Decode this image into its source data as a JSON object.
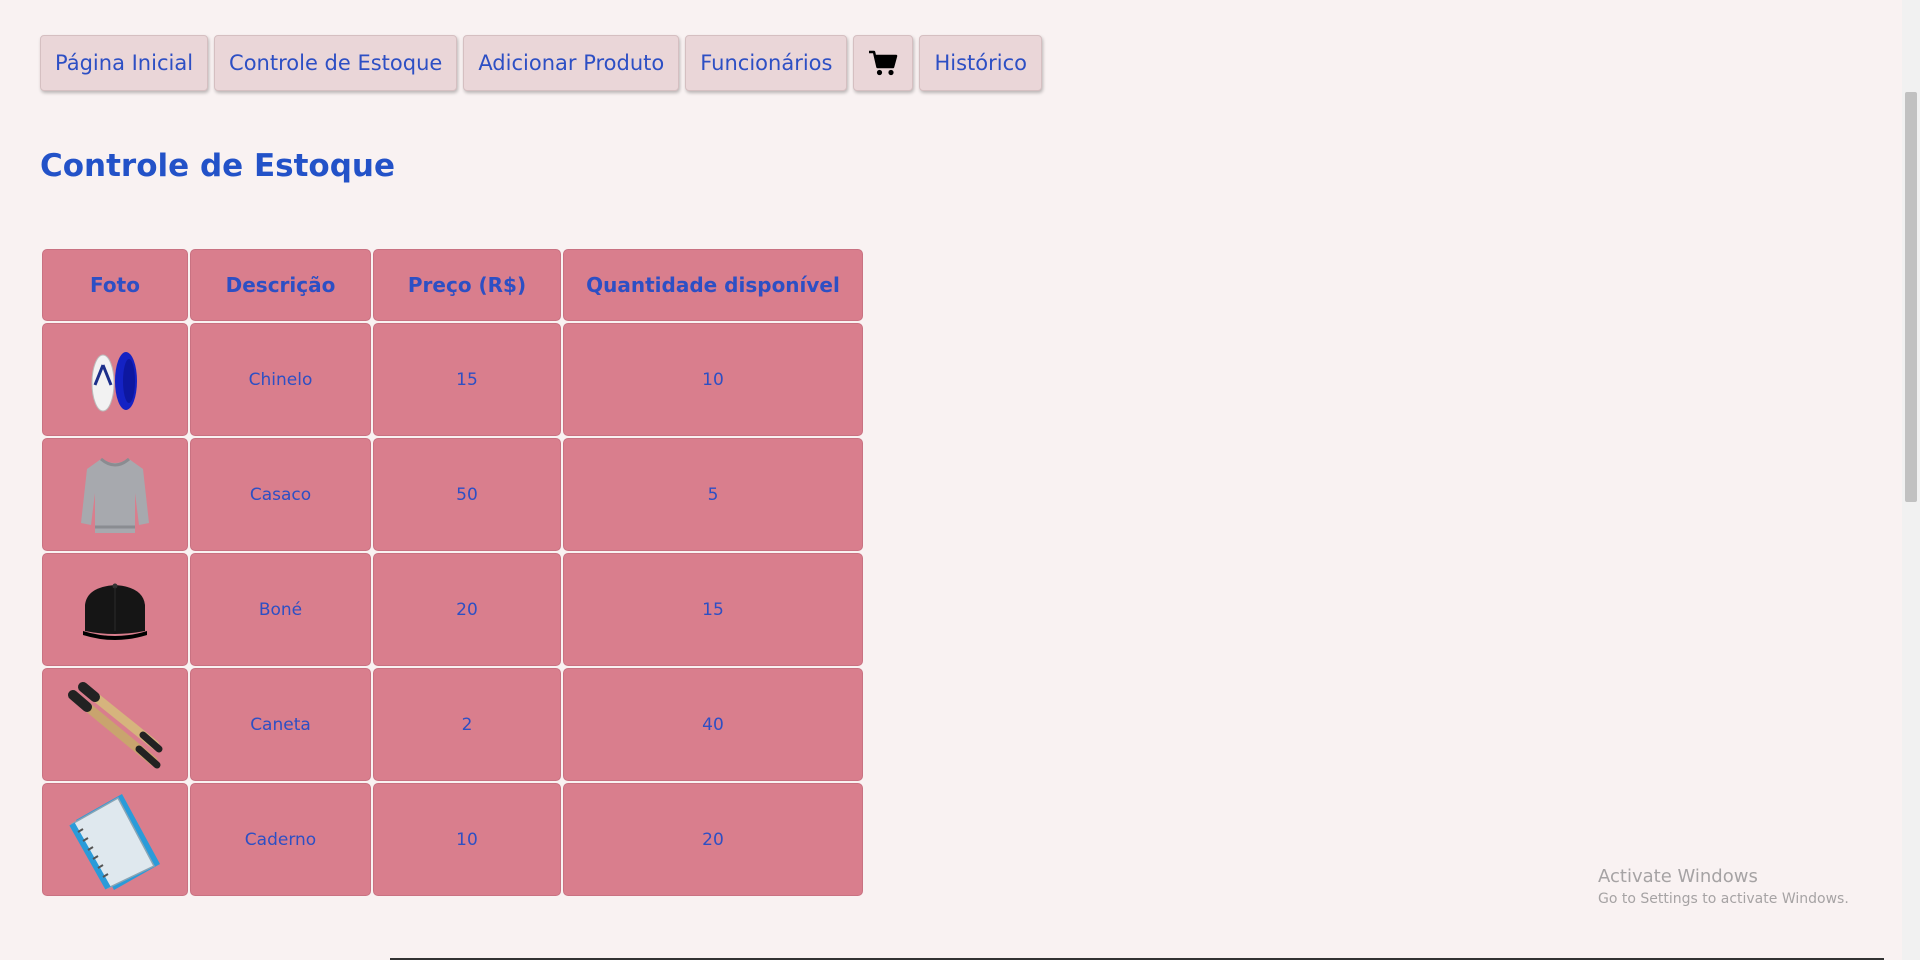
{
  "nav": {
    "items": [
      {
        "label": "Página Inicial"
      },
      {
        "label": "Controle de Estoque"
      },
      {
        "label": "Adicionar Produto"
      },
      {
        "label": "Funcionários"
      },
      {
        "icon": "shopping-cart-icon"
      },
      {
        "label": "Histórico"
      }
    ]
  },
  "page_title": "Controle de Estoque",
  "table": {
    "headers": [
      "Foto",
      "Descrição",
      "Preço (R$)",
      "Quantidade disponível"
    ],
    "rows": [
      {
        "icon": "flip-flop-icon",
        "descricao": "Chinelo",
        "preco": "15",
        "quantidade": "10"
      },
      {
        "icon": "sweatshirt-icon",
        "descricao": "Casaco",
        "preco": "50",
        "quantidade": "5"
      },
      {
        "icon": "cap-icon",
        "descricao": "Boné",
        "preco": "20",
        "quantidade": "15"
      },
      {
        "icon": "pens-icon",
        "descricao": "Caneta",
        "preco": "2",
        "quantidade": "40"
      },
      {
        "icon": "notebook-icon",
        "descricao": "Caderno",
        "preco": "10",
        "quantidade": "20"
      }
    ]
  },
  "watermark": {
    "line1": "Activate Windows",
    "line2": "Go to Settings to activate Windows."
  },
  "colors": {
    "background": "#f9f2f2",
    "nav_button": "#ead6d8",
    "table_cell": "#d97e8d",
    "text_accent": "#2d4fc4"
  }
}
